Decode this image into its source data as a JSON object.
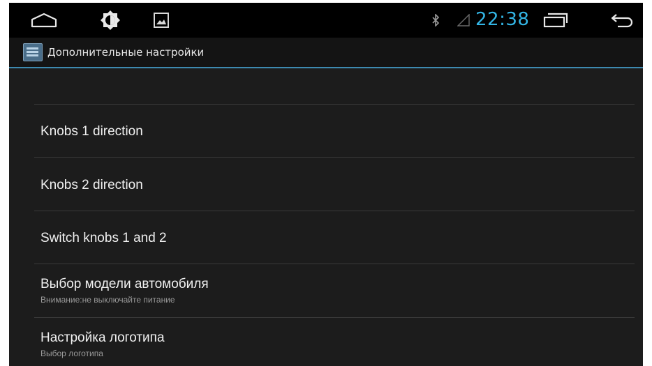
{
  "status_bar": {
    "time": "22:38",
    "time_color": "#33b5e5",
    "left_icons": [
      "home-icon",
      "brightness-icon",
      "gallery-icon"
    ],
    "right_icons": [
      "bluetooth-icon",
      "signal-icon",
      "recent-apps-icon",
      "back-icon"
    ]
  },
  "action_bar": {
    "icon": "settings-app-icon",
    "title": "Дополнительные настройки",
    "accent_color": "#3d8ab0"
  },
  "settings": {
    "items": [
      {
        "title": "Knobs 1 direction",
        "subtitle": ""
      },
      {
        "title": "Knobs 2 direction",
        "subtitle": ""
      },
      {
        "title": "Switch knobs 1 and 2",
        "subtitle": ""
      },
      {
        "title": "Выбор модели автомобиля",
        "subtitle": "Внимание:не выключайте питание"
      },
      {
        "title": "Настройка логотипа",
        "subtitle": "Выбор логотипа"
      }
    ]
  }
}
